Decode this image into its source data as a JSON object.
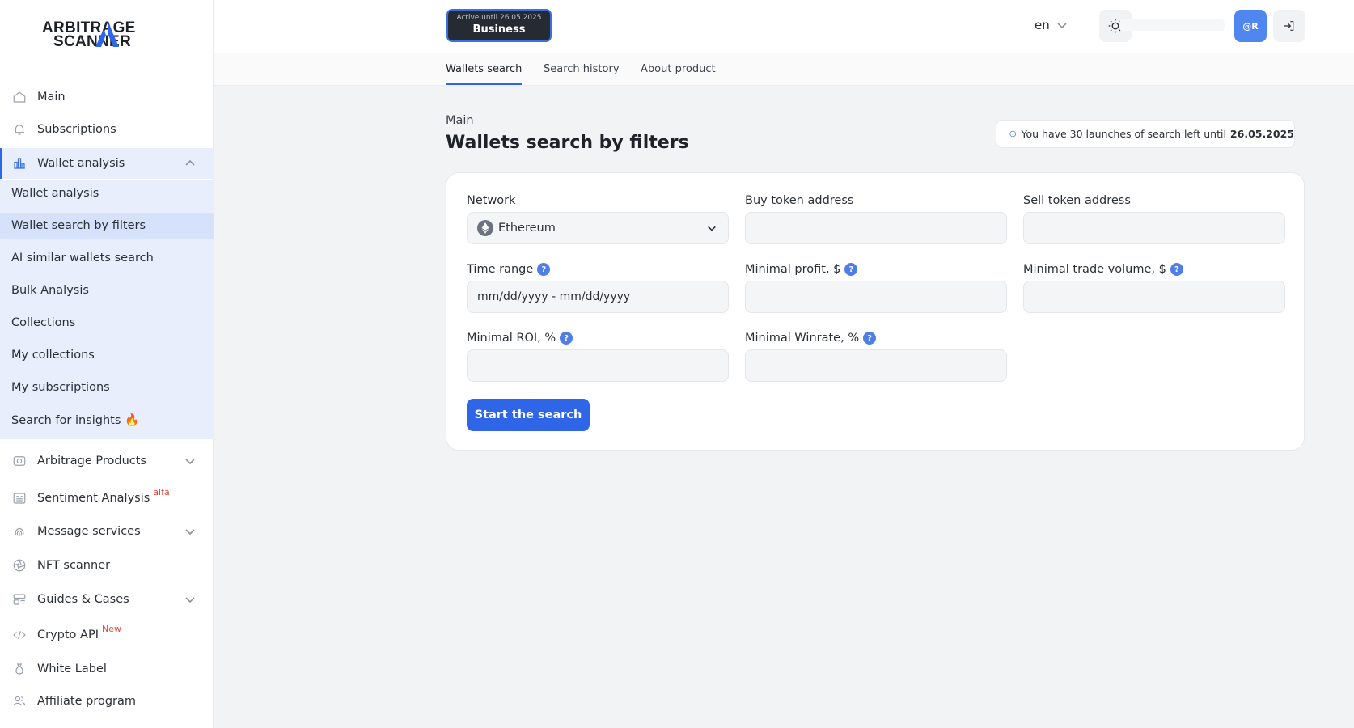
{
  "logo": {
    "line1": "ARBITRAGE",
    "line2": "SCANNER"
  },
  "sidebar": {
    "items": [
      {
        "label": "Main",
        "icon": "home-icon"
      },
      {
        "label": "Subscriptions",
        "icon": "bell-icon"
      },
      {
        "label": "Wallet analysis",
        "icon": "bar-chart-icon",
        "expanded": true
      },
      {
        "label": "Arbitrage Products",
        "icon": "target-icon"
      },
      {
        "label": "Sentiment Analysis",
        "icon": "news-icon",
        "badge": "alfa"
      },
      {
        "label": "Message services",
        "icon": "fingerprint-icon"
      },
      {
        "label": "NFT scanner",
        "icon": "aperture-icon"
      },
      {
        "label": "Guides & Cases",
        "icon": "layout-icon"
      },
      {
        "label": "Crypto API",
        "icon": "code-icon",
        "badge": "New"
      },
      {
        "label": "White Label",
        "icon": "bag-icon"
      },
      {
        "label": "Affiliate program",
        "icon": "users-icon"
      }
    ],
    "submenu": [
      "Wallet analysis",
      "Wallet search by filters",
      "AI similar wallets search",
      "Bulk Analysis",
      "Collections",
      "My collections",
      "My subscriptions",
      "Search for insights 🔥"
    ]
  },
  "header": {
    "plan_small": "Active until 26.05.2025",
    "plan_name": "Business",
    "lang": "en",
    "avatar": "@R"
  },
  "tabs": [
    "Wallets search",
    "Search history",
    "About product"
  ],
  "main": {
    "breadcrumb": "Main",
    "title": "Wallets search by filters",
    "info_text": "You have 30 launches of search left until",
    "info_date": "26.05.2025"
  },
  "form": {
    "network_label": "Network",
    "network_value": "Ethereum",
    "buy_label": "Buy token address",
    "sell_label": "Sell token address",
    "time_label": "Time range",
    "time_placeholder": "mm/dd/yyyy - mm/dd/yyyy",
    "profit_label": "Minimal profit, $",
    "volume_label": "Minimal trade volume, $",
    "roi_label": "Minimal ROI, %",
    "winrate_label": "Minimal Winrate, %",
    "help_mark": "?",
    "submit": "Start the search"
  },
  "colors": {
    "accent": "#2f66e8",
    "active_bg": "#e8eefc",
    "badge_red": "#e0463b"
  }
}
